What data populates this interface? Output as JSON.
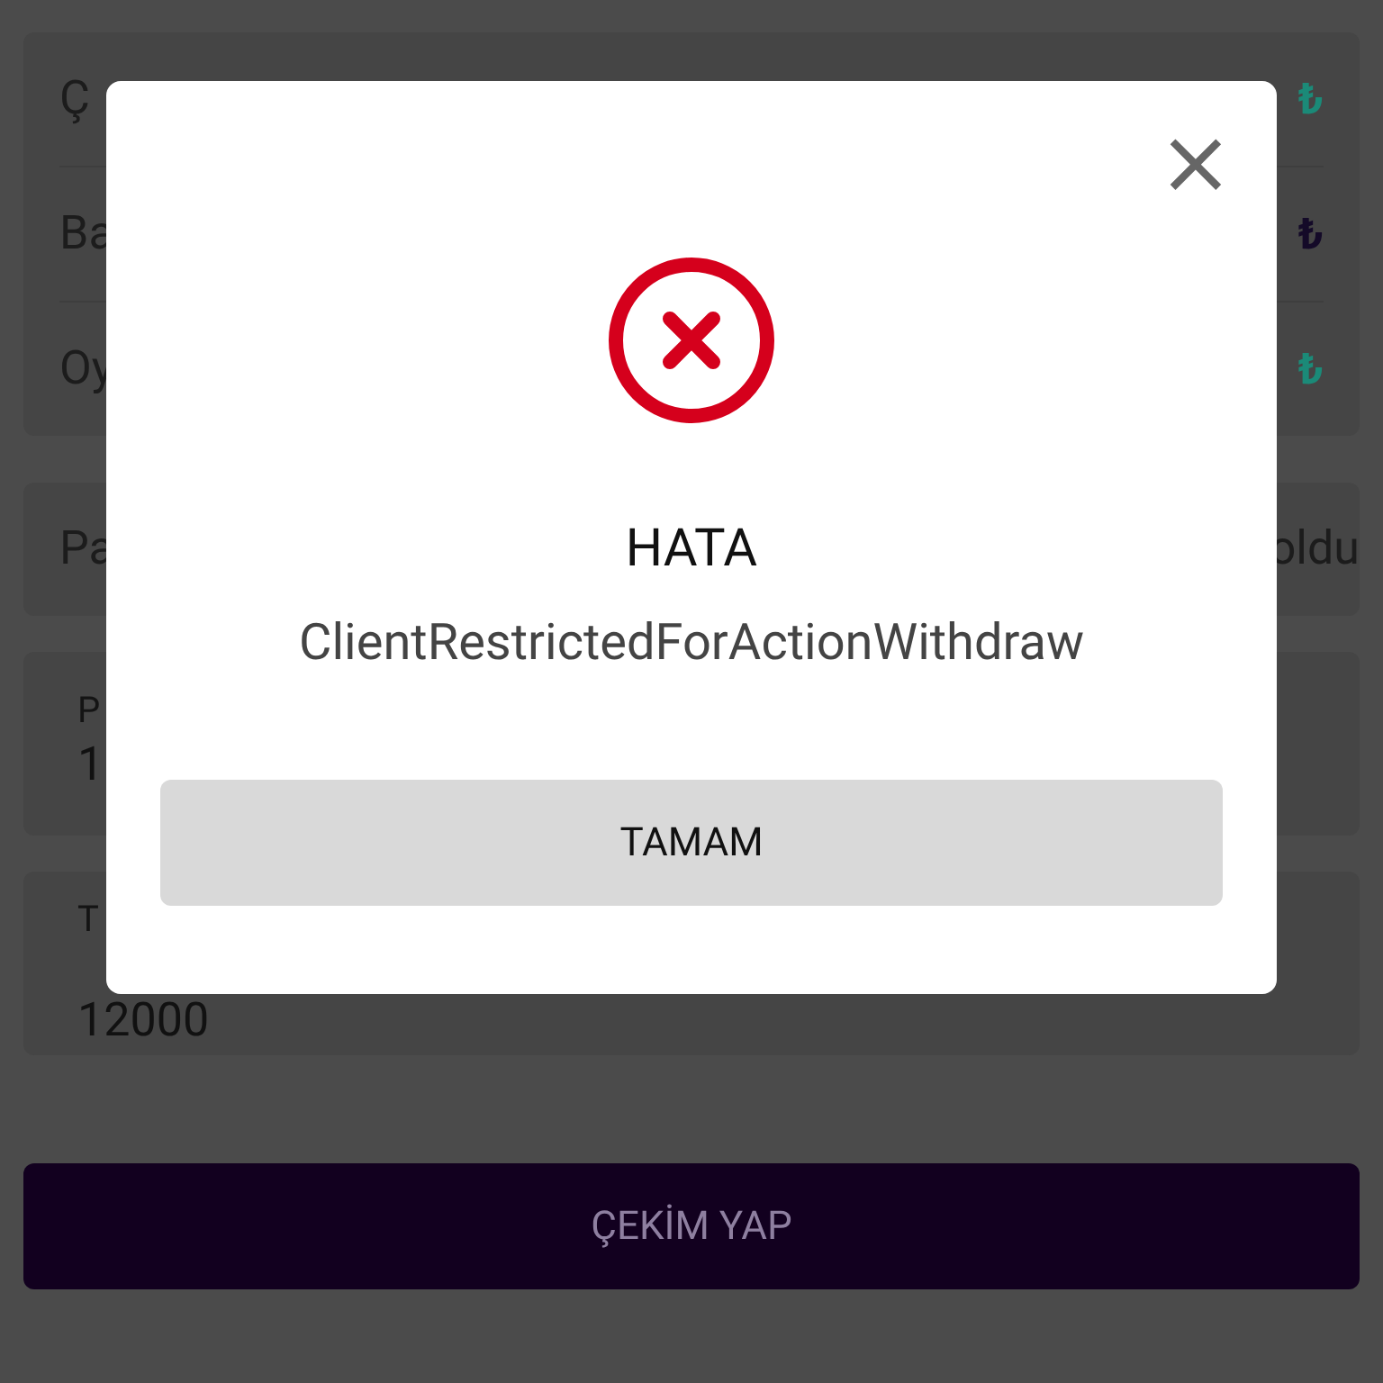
{
  "summary": {
    "rows": [
      {
        "label": "Ç",
        "amount": "₺",
        "color": "#1b8a78"
      },
      {
        "label": "Ba",
        "amount": "₺",
        "color": "#140a28"
      },
      {
        "label": "Oy",
        "amount": "₺",
        "color": "#1b8a78"
      }
    ]
  },
  "payment": {
    "label": "Pa",
    "note": "oldu"
  },
  "fields": [
    {
      "label": "P",
      "value": "1"
    },
    {
      "label": "T",
      "value": "12000"
    }
  ],
  "submit": {
    "label": "ÇEKİM YAP",
    "disabled": true
  },
  "dialog": {
    "close": "×",
    "title": "HATA",
    "message": "ClientRestrictedForActionWithdraw",
    "button": "TAMAM"
  }
}
